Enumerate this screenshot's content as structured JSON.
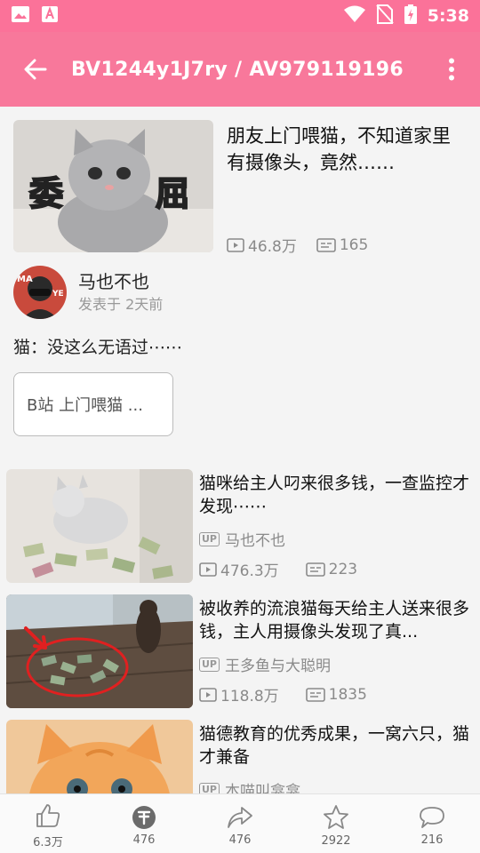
{
  "status_bar": {
    "time": "5:38"
  },
  "app_bar": {
    "title": "BV1244y1J7ry / AV979119196"
  },
  "video": {
    "title": "朋友上门喂猫，不知道家里有摄像头，竟然……",
    "views": "46.8万",
    "danmaku": "165",
    "thumb_caption_left": "委",
    "thumb_caption_right": "屈"
  },
  "author": {
    "name": "马也不也",
    "posted": "发表于 2天前"
  },
  "description": "猫：没这么无语过⋯⋯",
  "tags": [
    "B站 上门喂猫 ..."
  ],
  "related_up_badge": "UP",
  "related": [
    {
      "title": "猫咪给主人叼来很多钱，一查监控才发现⋯⋯",
      "up": "马也不也",
      "views": "476.3万",
      "danmaku": "223"
    },
    {
      "title": "被收养的流浪猫每天给主人送来很多钱，主人用摄像头发现了真...",
      "up": "王多鱼与大聪明",
      "views": "118.8万",
      "danmaku": "1835"
    },
    {
      "title": "猫德教育的优秀成果，一窝六只，猫才兼备",
      "up": "本喵叫龛龛",
      "views": "",
      "danmaku": ""
    }
  ],
  "bottom_bar": [
    {
      "icon": "like-icon",
      "label": "6.3万"
    },
    {
      "icon": "coin-icon",
      "label": "476"
    },
    {
      "icon": "share-icon",
      "label": "476"
    },
    {
      "icon": "favorite-icon",
      "label": "2922"
    },
    {
      "icon": "comment-icon",
      "label": "216"
    }
  ],
  "colors": {
    "accent": "#fb7299",
    "app_bar": "#f8789b"
  }
}
